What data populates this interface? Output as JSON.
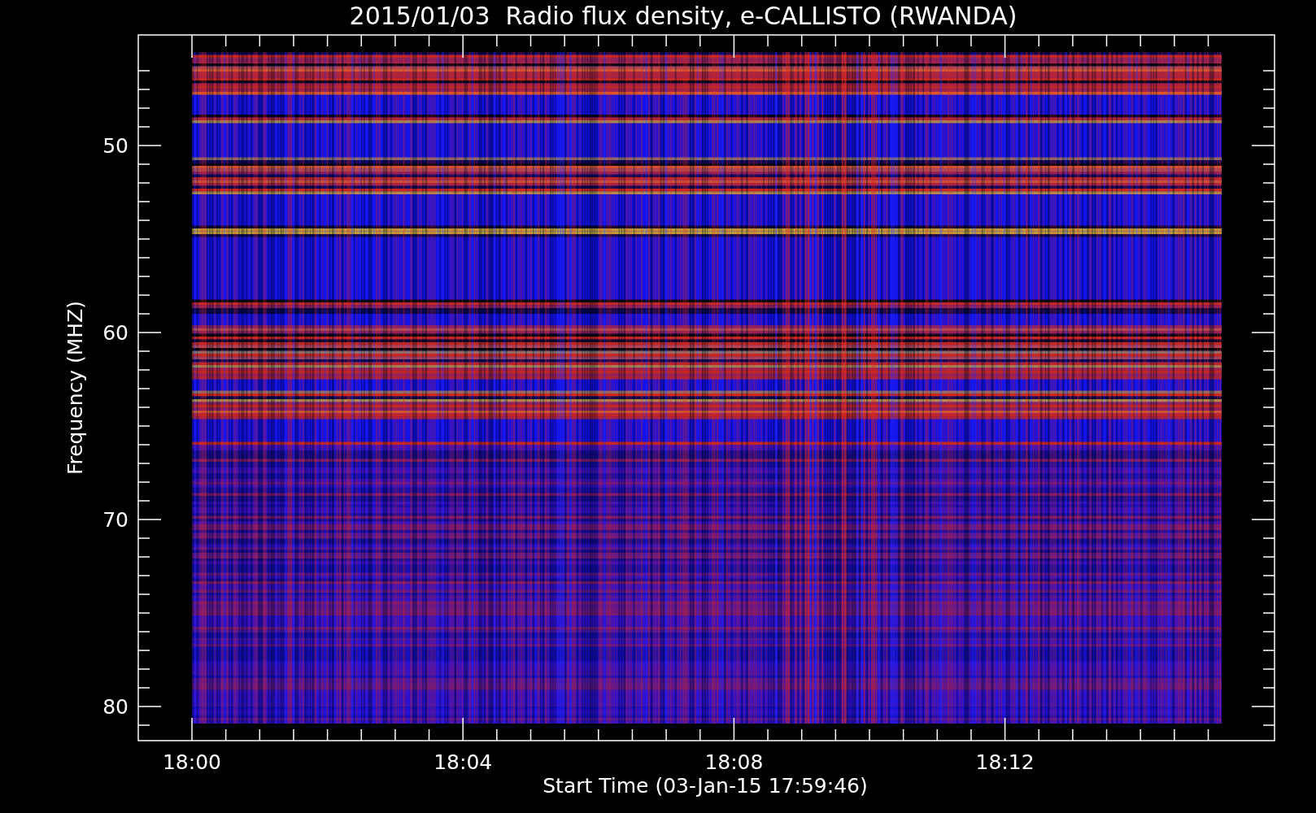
{
  "title": "2015/01/03  Radio flux density, e-CALLISTO (RWANDA)",
  "y_axis": {
    "label": "Frequency (MHZ)",
    "ticks": [
      "50",
      "60",
      "70",
      "80"
    ]
  },
  "x_axis": {
    "label": "Start Time (03-Jan-15 17:59:46)",
    "ticks": [
      "18:00",
      "18:04",
      "18:08",
      "18:12"
    ]
  }
}
